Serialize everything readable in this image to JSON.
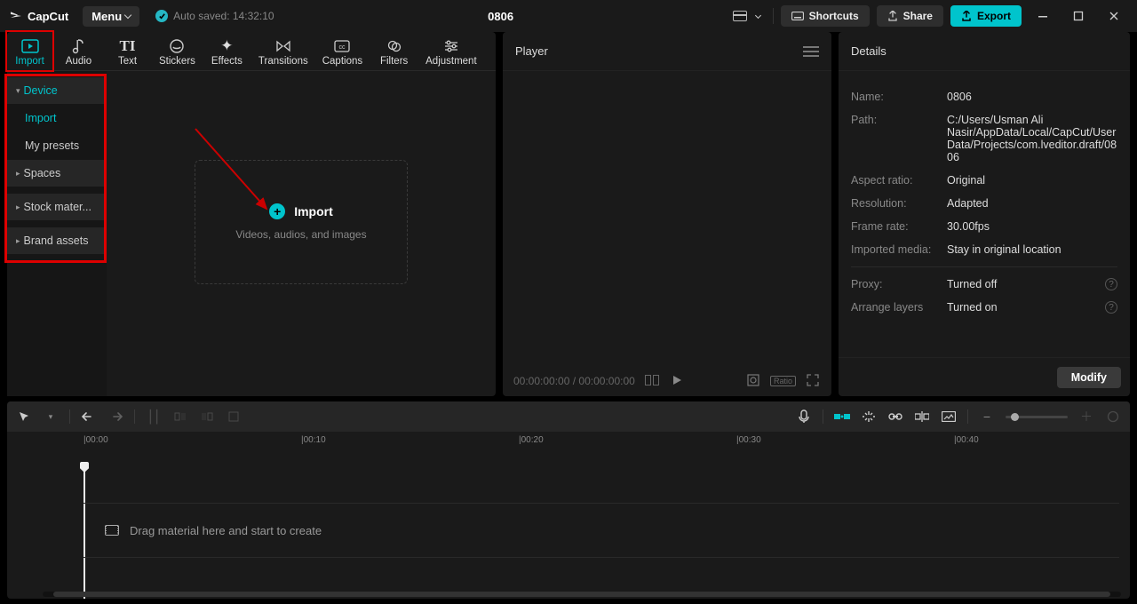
{
  "app": {
    "name": "CapCut"
  },
  "menu": {
    "label": "Menu"
  },
  "autosave": {
    "text": "Auto saved: 14:32:10"
  },
  "project": {
    "title": "0806"
  },
  "titlebar": {
    "shortcuts": "Shortcuts",
    "share": "Share",
    "export": "Export"
  },
  "tabs": [
    {
      "label": "Import"
    },
    {
      "label": "Audio"
    },
    {
      "label": "Text"
    },
    {
      "label": "Stickers"
    },
    {
      "label": "Effects"
    },
    {
      "label": "Transitions"
    },
    {
      "label": "Captions"
    },
    {
      "label": "Filters"
    },
    {
      "label": "Adjustment"
    }
  ],
  "sidebar": {
    "device": "Device",
    "import": "Import",
    "presets": "My presets",
    "spaces": "Spaces",
    "stock": "Stock mater...",
    "brand": "Brand assets"
  },
  "importBox": {
    "label": "Import",
    "sub": "Videos, audios, and images"
  },
  "player": {
    "title": "Player",
    "time_current": "00:00:00:00",
    "time_total": "00:00:00:00"
  },
  "details": {
    "title": "Details",
    "name_k": "Name:",
    "name_v": "0806",
    "path_k": "Path:",
    "path_v": "C:/Users/Usman Ali Nasir/AppData/Local/CapCut/User Data/Projects/com.lveditor.draft/0806",
    "aspect_k": "Aspect ratio:",
    "aspect_v": "Original",
    "res_k": "Resolution:",
    "res_v": "Adapted",
    "fps_k": "Frame rate:",
    "fps_v": "30.00fps",
    "imported_k": "Imported media:",
    "imported_v": "Stay in original location",
    "proxy_k": "Proxy:",
    "proxy_v": "Turned off",
    "layers_k": "Arrange layers",
    "layers_v": "Turned on",
    "modify": "Modify"
  },
  "timeline": {
    "ticks": [
      "00:00",
      "00:10",
      "00:20",
      "00:30",
      "00:40"
    ],
    "placeholder": "Drag material here and start to create"
  }
}
